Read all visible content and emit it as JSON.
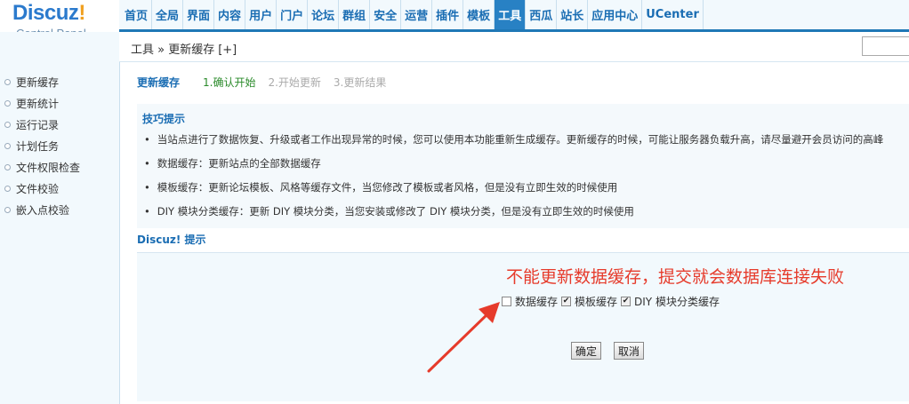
{
  "logo": {
    "main": "Discuz",
    "bang": "!",
    "sub": "Control Panel"
  },
  "topnav": [
    {
      "label": "首页",
      "active": false
    },
    {
      "label": "全局",
      "active": false
    },
    {
      "label": "界面",
      "active": false
    },
    {
      "label": "内容",
      "active": false
    },
    {
      "label": "用户",
      "active": false
    },
    {
      "label": "门户",
      "active": false
    },
    {
      "label": "论坛",
      "active": false
    },
    {
      "label": "群组",
      "active": false
    },
    {
      "label": "安全",
      "active": false
    },
    {
      "label": "运营",
      "active": false
    },
    {
      "label": "插件",
      "active": false
    },
    {
      "label": "模板",
      "active": false
    },
    {
      "label": "工具",
      "active": true
    },
    {
      "label": "西瓜",
      "active": false
    },
    {
      "label": "站长",
      "active": false
    },
    {
      "label": "应用中心",
      "active": false
    },
    {
      "label": "UCenter",
      "active": false
    }
  ],
  "breadcrumb": {
    "text": "工具 » 更新缓存",
    "add": "[+]"
  },
  "sidebar": {
    "items": [
      {
        "label": "更新缓存"
      },
      {
        "label": "更新统计"
      },
      {
        "label": "运行记录"
      },
      {
        "label": "计划任务"
      },
      {
        "label": "文件权限检查"
      },
      {
        "label": "文件校验"
      },
      {
        "label": "嵌入点校验"
      }
    ]
  },
  "steps": {
    "title": "更新缓存",
    "items": [
      {
        "label": "1.确认开始",
        "current": true
      },
      {
        "label": "2.开始更新",
        "current": false
      },
      {
        "label": "3.更新结果",
        "current": false
      }
    ]
  },
  "tips": {
    "title": "技巧提示",
    "bullet": "•",
    "items": [
      "当站点进行了数据恢复、升级或者工作出现异常的时候，您可以使用本功能重新生成缓存。更新缓存的时候，可能让服务器负载升高，请尽量避开会员访问的高峰",
      "数据缓存：更新站点的全部数据缓存",
      "模板缓存：更新论坛模板、风格等缓存文件，当您修改了模板或者风格，但是没有立即生效的时候使用",
      "DIY 模块分类缓存：更新 DIY 模块分类，当您安装或修改了 DIY 模块分类，但是没有立即生效的时候使用"
    ]
  },
  "discuz_tip": {
    "title": "Discuz! 提示"
  },
  "form": {
    "annotation": "不能更新数据缓存，提交就会数据库连接失败",
    "options": [
      {
        "label": "数据缓存",
        "checked": false
      },
      {
        "label": "模板缓存",
        "checked": true
      },
      {
        "label": "DIY 模块分类缓存",
        "checked": true
      }
    ],
    "confirm": "确定",
    "cancel": "取消"
  },
  "colors": {
    "accent": "#1a6db3",
    "annotation": "#e63b2b",
    "active_tab": "#2881c4"
  }
}
